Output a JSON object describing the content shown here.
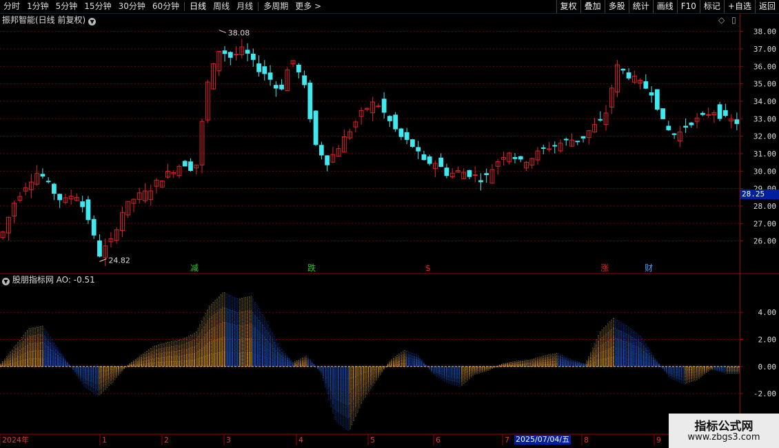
{
  "toolbar": {
    "periods": [
      "分时",
      "1分钟",
      "5分钟",
      "15分钟",
      "30分钟",
      "60分钟",
      "日线",
      "周线",
      "月线",
      "多周期",
      "更多 >"
    ],
    "active_period": "日线",
    "tools": [
      "复权",
      "叠加",
      "多股",
      "统计",
      "画线",
      "F10",
      "标记",
      "+自选",
      "返回"
    ]
  },
  "stock": {
    "title": "振邦智能(日线 前复权)",
    "current_price_label": "28.25"
  },
  "indicator": {
    "title": "股朋指标网 AO: -0.51"
  },
  "cursor": {
    "date_label": "2025/07/04/五"
  },
  "watermark": {
    "line1": "指标公式网",
    "line2": "www.zbgs3.com"
  },
  "colors": {
    "up": "#e0202a",
    "down": "#40e8f0",
    "grid": "#7a0000",
    "text": "#dddddd",
    "badge_bg": "#0020a0"
  },
  "chart_data": [
    {
      "type": "candlestick",
      "title": "振邦智能(日线 前复权)",
      "y_ticks": [
        38.0,
        37.0,
        36.0,
        35.0,
        34.0,
        33.0,
        32.0,
        31.0,
        30.0,
        29.0,
        28.0,
        27.0,
        26.0
      ],
      "ylim": [
        24.8,
        38.3
      ],
      "annotations": [
        {
          "type": "high",
          "label": "38.08",
          "value": 38.08
        },
        {
          "type": "low",
          "label": "24.82",
          "value": 24.82
        }
      ],
      "event_markers": [
        {
          "label": "减",
          "color": "#22cc22"
        },
        {
          "label": "跌",
          "color": "#22cc22"
        },
        {
          "label": "$",
          "color": "#ee2222"
        },
        {
          "label": "涨",
          "color": "#ee2222"
        },
        {
          "label": "财",
          "color": "#4aa0ff"
        }
      ],
      "approx_close_path": [
        26.5,
        28.3,
        29.3,
        30.0,
        29.0,
        28.2,
        28.8,
        27.5,
        25.2,
        26.0,
        27.8,
        28.5,
        28.8,
        29.5,
        30.0,
        30.5,
        30.0,
        35.0,
        37.0,
        36.5,
        37.0,
        36.0,
        35.5,
        34.5,
        36.5,
        35.0,
        31.5,
        30.5,
        31.5,
        32.5,
        33.5,
        34.0,
        33.0,
        32.0,
        31.5,
        30.5,
        30.5,
        29.8,
        30.0,
        29.8,
        29.5,
        30.5,
        31.2,
        30.5,
        30.8,
        31.3,
        31.5,
        31.8,
        31.8,
        32.5,
        33.0,
        36.0,
        35.5,
        35.0,
        34.5,
        32.5,
        32.0,
        32.8,
        33.0,
        33.5,
        33.0,
        32.8
      ]
    },
    {
      "type": "histogram",
      "title": "股朋指标网 AO: -0.51",
      "current_value": -0.51,
      "y_ticks": [
        4.0,
        2.0,
        0.0,
        -2.0
      ],
      "ylim": [
        -5.0,
        6.2
      ],
      "approx_ao_path": [
        0.2,
        1.5,
        2.8,
        3.0,
        1.5,
        0.0,
        -1.5,
        -2.2,
        -1.2,
        0.0,
        0.8,
        1.5,
        1.8,
        2.0,
        2.5,
        4.5,
        5.5,
        5.0,
        5.2,
        3.5,
        1.5,
        0.3,
        0.8,
        -0.5,
        -4.0,
        -4.8,
        -2.5,
        -1.0,
        0.5,
        1.2,
        0.8,
        -0.5,
        -1.2,
        -1.5,
        -0.6,
        -0.3,
        0.2,
        0.4,
        0.5,
        0.8,
        1.0,
        0.5,
        0.2,
        2.5,
        3.6,
        3.0,
        2.2,
        0.6,
        -0.8,
        -1.3,
        -1.0,
        -0.2,
        -0.5,
        -0.5
      ]
    }
  ],
  "x_axis": {
    "labels": [
      "2024年",
      "1",
      "2",
      "3",
      "4",
      "5",
      "6",
      "7",
      "8",
      "9"
    ]
  }
}
